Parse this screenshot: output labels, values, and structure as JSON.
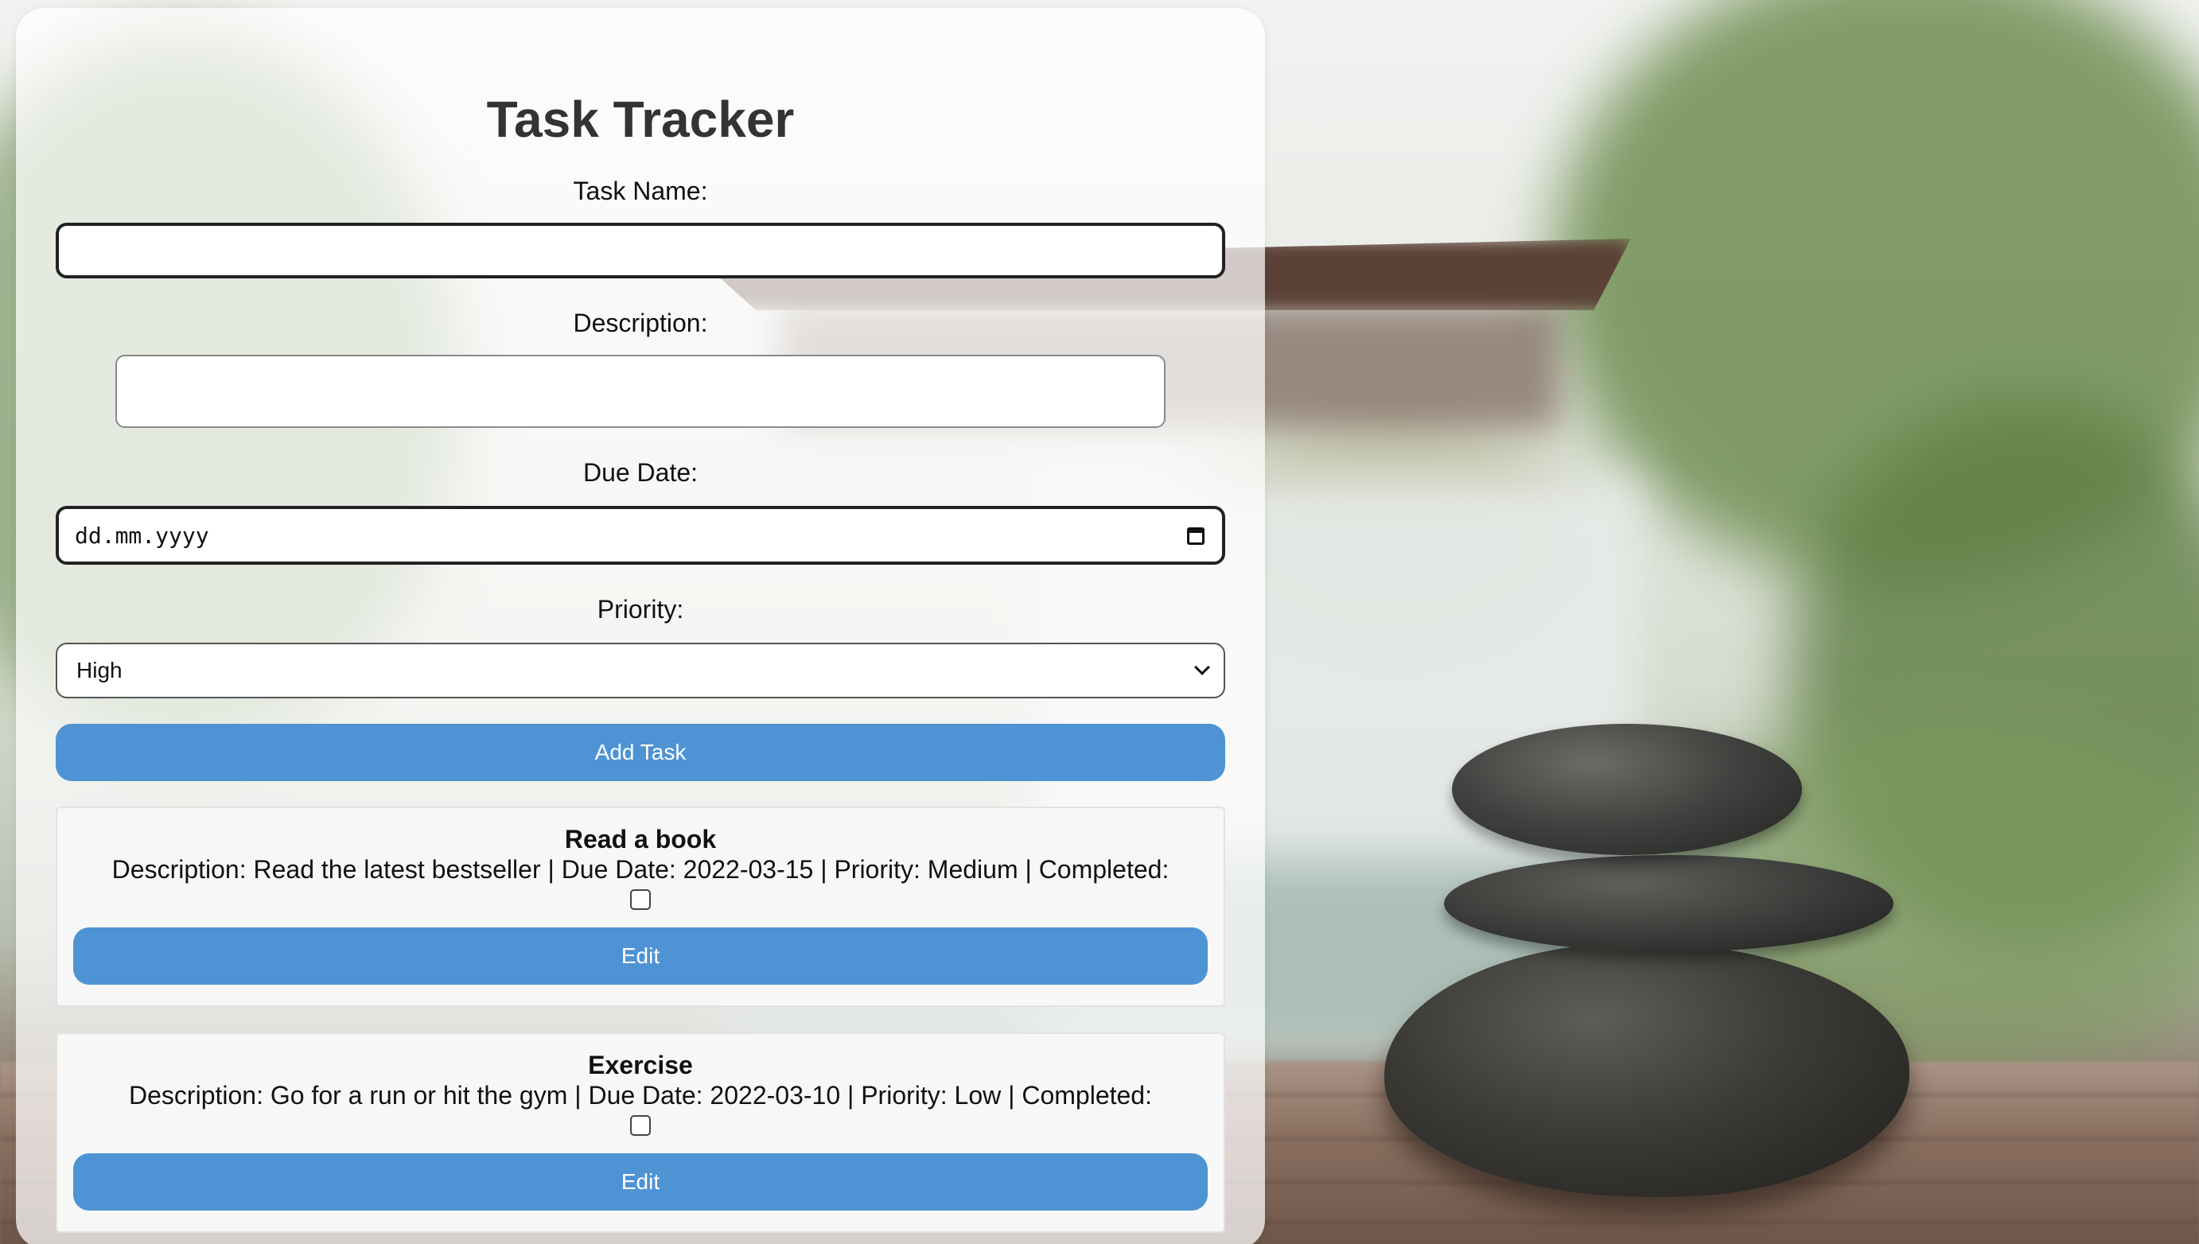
{
  "app": {
    "title": "Task Tracker"
  },
  "form": {
    "task_name_label": "Task Name:",
    "task_name_value": "",
    "description_label": "Description:",
    "description_value": "",
    "due_date_label": "Due Date:",
    "due_date_placeholder": "dd.mm.yyyy",
    "priority_label": "Priority:",
    "priority_selected": "High",
    "add_button_label": "Add Task"
  },
  "tasks": [
    {
      "title": "Read a book",
      "details": "Description: Read the latest bestseller | Due Date: 2022-03-15 | Priority: Medium | Completed:",
      "completed": false,
      "edit_label": "Edit"
    },
    {
      "title": "Exercise",
      "details": "Description: Go for a run or hit the gym | Due Date: 2022-03-10 | Priority: Low | Completed:",
      "completed": false,
      "edit_label": "Edit"
    }
  ],
  "colors": {
    "button": "#4e93d4",
    "title_text": "#333333"
  },
  "icons": {
    "date_picker": "calendar-icon",
    "select": "chevron-down-icon"
  }
}
